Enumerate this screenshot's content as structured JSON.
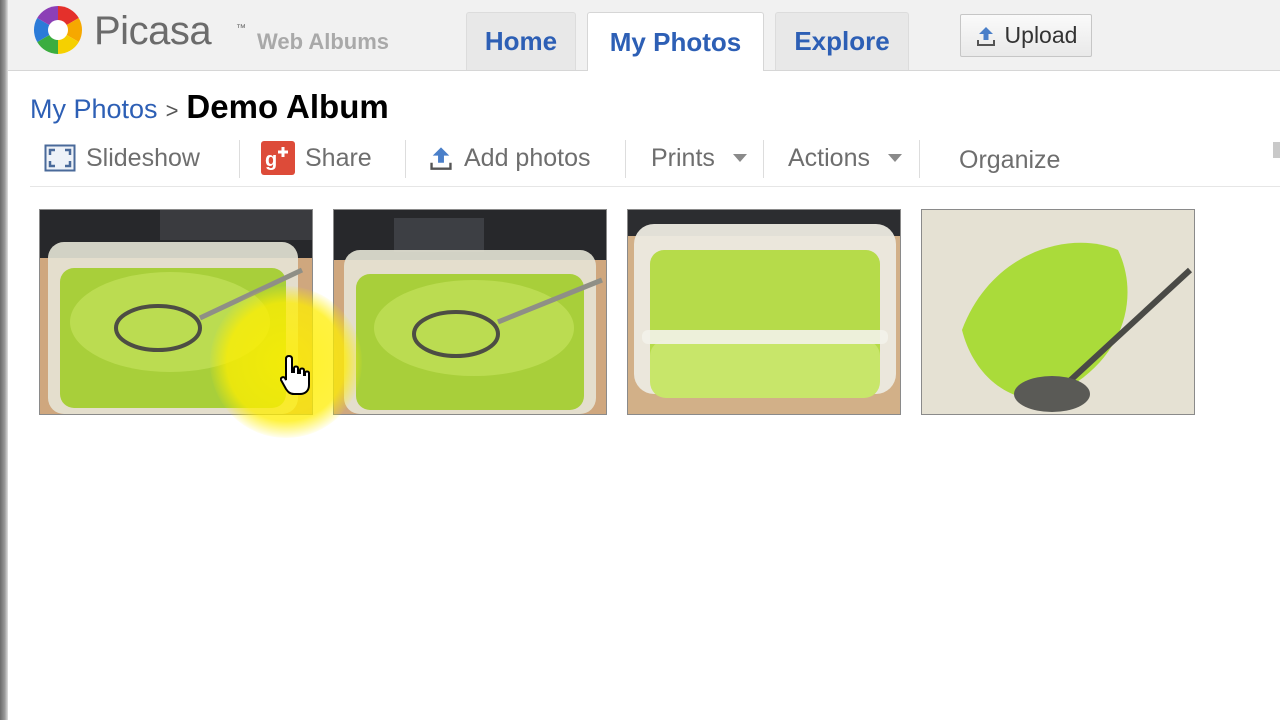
{
  "app": {
    "logo_text": "Picasa",
    "logo_tm": "™",
    "logo_subtitle": "Web Albums"
  },
  "nav": {
    "tabs": [
      {
        "label": "Home",
        "active": false
      },
      {
        "label": "My Photos",
        "active": true
      },
      {
        "label": "Explore",
        "active": false
      }
    ],
    "upload_label": "Upload"
  },
  "breadcrumb": {
    "parent": "My Photos",
    "separator": ">",
    "current": "Demo Album"
  },
  "toolbar": {
    "slideshow": "Slideshow",
    "share": "Share",
    "add_photos": "Add photos",
    "prints": "Prints",
    "actions": "Actions",
    "organize": "Organize"
  },
  "icons": {
    "logo": "picasa-pinwheel-icon",
    "upload": "upload-arrow-icon",
    "slideshow": "fullscreen-icon",
    "share": "google-plus-icon",
    "add_photos": "upload-arrow-icon",
    "dropdown": "caret-down-icon",
    "cursor": "hand-pointer-icon"
  },
  "colors": {
    "link_blue": "#2d5fb5",
    "google_plus_red": "#dd4b39",
    "highlight_yellow": "#ffee00"
  },
  "photos": [
    {
      "subject": "spoon-in-green-jelly"
    },
    {
      "subject": "spoon-in-green-jelly"
    },
    {
      "subject": "green-jelly-container"
    },
    {
      "subject": "spoon-in-green-jelly-closeup"
    }
  ]
}
